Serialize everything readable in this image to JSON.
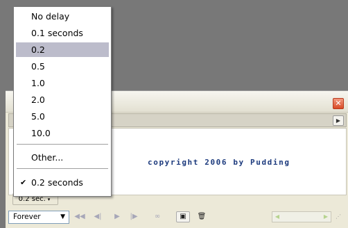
{
  "colors": {
    "desktop": "#787878",
    "panel": "#ece9d8",
    "selected_item": "#bcbccb",
    "copyright_text": "#1c3a7d",
    "close_button": "#d84a26"
  },
  "panel": {
    "copyright": "copyright 2006 by Pudding",
    "delay_button": {
      "label": "0.2 sec.",
      "icon": "dropdown-arrow-icon"
    },
    "toolbar": {
      "loop_select": {
        "value": "Forever",
        "icon": "chevron-down-icon"
      },
      "buttons": [
        "rewind-icon",
        "step-back-icon",
        "play-icon",
        "step-forward-icon",
        "tween-icon",
        "new-frame-icon",
        "delete-frame-icon"
      ]
    }
  },
  "dropdown": {
    "items": [
      "No delay",
      "0.1 seconds",
      "0.2",
      "0.5",
      "1.0",
      "2.0",
      "5.0",
      "10.0"
    ],
    "selected_index": 2,
    "other": "Other...",
    "current": "0.2 seconds",
    "current_icon": "checkmark-icon"
  }
}
